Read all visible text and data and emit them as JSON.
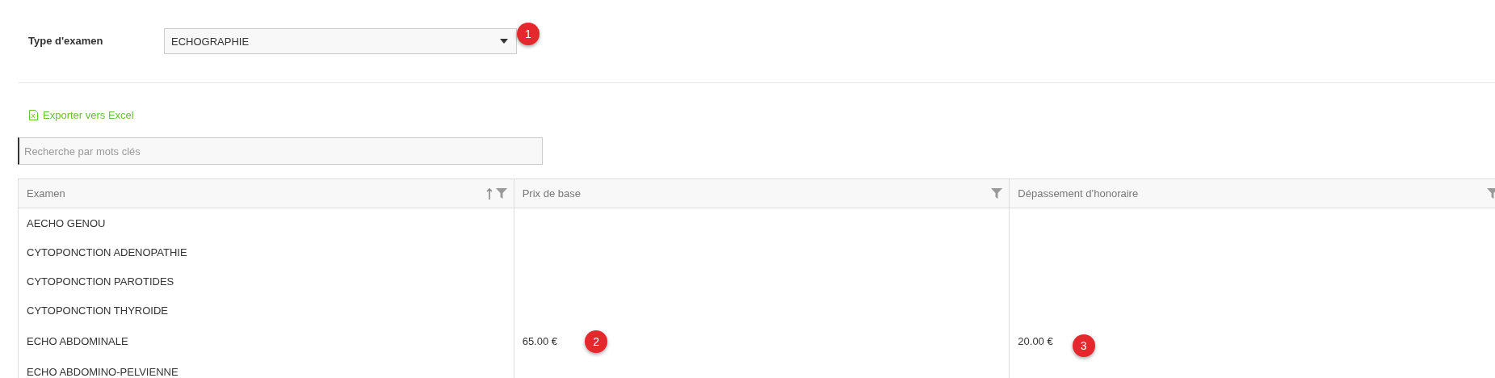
{
  "exam_type": {
    "label": "Type d'examen",
    "value": "ECHOGRAPHIE",
    "badge": "1"
  },
  "export_link": {
    "label": "Exporter vers Excel"
  },
  "search": {
    "placeholder": "Recherche par mots clés"
  },
  "table": {
    "columns": [
      {
        "label": "Examen",
        "sortable": true
      },
      {
        "label": "Prix de base",
        "sortable": false
      },
      {
        "label": "Dépassement d’honoraire",
        "sortable": false
      }
    ],
    "rows": [
      {
        "cells": [
          {
            "text": "AECHO GENOU"
          },
          {},
          {}
        ]
      },
      {
        "cells": [
          {
            "text": "CYTOPONCTION ADENOPATHIE"
          },
          {},
          {}
        ]
      },
      {
        "cells": [
          {
            "text": "CYTOPONCTION PAROTIDES"
          },
          {},
          {}
        ]
      },
      {
        "cells": [
          {
            "text": "CYTOPONCTION THYROIDE"
          },
          {},
          {}
        ]
      },
      {
        "cells": [
          {
            "text": "ECHO ABDOMINALE"
          },
          {
            "text": "65.00 €",
            "badge": "2"
          },
          {
            "text": "20.00 €",
            "badge": "3"
          }
        ]
      },
      {
        "cells": [
          {
            "text": "ECHO ABDOMINO-PELVIENNE"
          },
          {},
          {}
        ]
      }
    ]
  }
}
